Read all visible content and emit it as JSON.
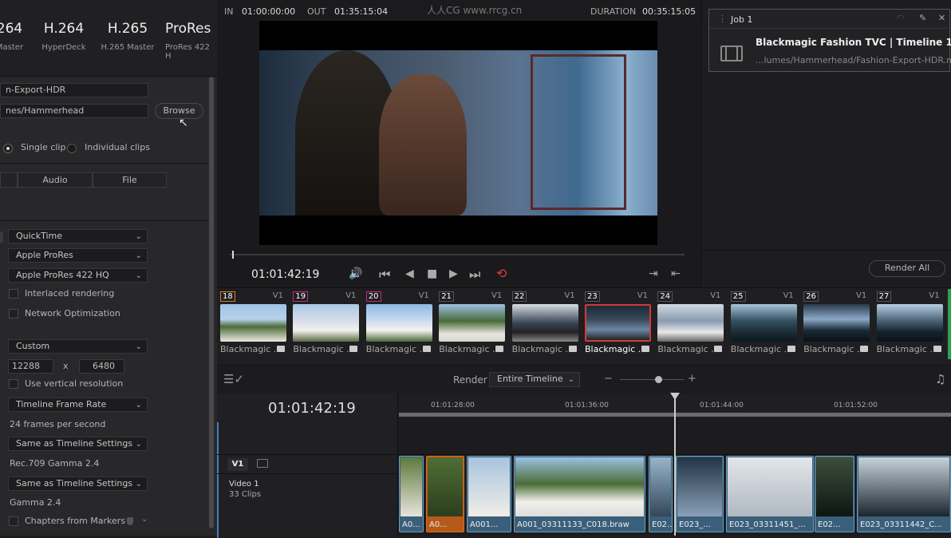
{
  "presets": [
    {
      "title": "264",
      "sub": "Master"
    },
    {
      "title": "H.264",
      "sub": "HyperDeck"
    },
    {
      "title": "H.265",
      "sub": "H.265 Master"
    },
    {
      "title": "ProRes",
      "sub": "ProRes 422 H"
    }
  ],
  "left": {
    "filename": "n-Export-HDR",
    "location": "nes/Hammerhead",
    "browse": "Browse",
    "single_clip": "Single clip",
    "individual_clips": "Individual clips",
    "tabs": [
      "Audio",
      "File"
    ],
    "format": "QuickTime",
    "codec": "Apple ProRes",
    "type": "Apple ProRes 422 HQ",
    "interlaced": "Interlaced rendering",
    "network_opt": "Network Optimization",
    "resolution": "Custom",
    "res_w": "12288",
    "res_x": "x",
    "res_h": "6480",
    "vertical": "Use vertical resolution",
    "frame_rate": "Timeline Frame Rate",
    "fps": "24 frames per second",
    "color_space": "Same as Timeline Settings",
    "color_space_val": "Rec.709 Gamma 2.4",
    "gamma": "Same as Timeline Settings",
    "gamma_val": "Gamma 2.4",
    "chapters": "Chapters from Markers"
  },
  "viewer": {
    "in_label": "IN",
    "in_tc": "01:00:00:00",
    "out_label": "OUT",
    "out_tc": "01:35:15:04",
    "watermark": "人人CG www.rrcg.cn",
    "duration_label": "DURATION",
    "duration_tc": "00:35:15:05",
    "timecode": "01:01:42:19"
  },
  "queue": {
    "job": "Job 1",
    "title": "Blackmagic Fashion TVC | Timeline 1",
    "path": "...lumes/Hammerhead/Fashion-Export-HDR.mov",
    "render_all": "Render All"
  },
  "thumbs": [
    {
      "num": "18",
      "track": "V1",
      "name": "Blackmagic ...",
      "color": "#e07a1a"
    },
    {
      "num": "19",
      "track": "V1",
      "name": "Blackmagic ...",
      "color": "#c02a8a"
    },
    {
      "num": "20",
      "track": "V1",
      "name": "Blackmagic ...",
      "color": "#c02a8a"
    },
    {
      "num": "21",
      "track": "V1",
      "name": "Blackmagic ...",
      "color": "#555"
    },
    {
      "num": "22",
      "track": "V1",
      "name": "Blackmagic ...",
      "color": "#555"
    },
    {
      "num": "23",
      "track": "V1",
      "name": "Blackmagic ...",
      "color": "#555"
    },
    {
      "num": "24",
      "track": "V1",
      "name": "Blackmagic ...",
      "color": "#555"
    },
    {
      "num": "25",
      "track": "V1",
      "name": "Blackmagic ...",
      "color": "#555"
    },
    {
      "num": "26",
      "track": "V1",
      "name": "Blackmagic ...",
      "color": "#555"
    },
    {
      "num": "27",
      "track": "V1",
      "name": "Blackmagic ...",
      "color": "#555"
    }
  ],
  "timeline": {
    "render_label": "Render",
    "render_mode": "Entire Timeline",
    "timecode": "01:01:42:19",
    "ruler": [
      "01:01:28:00",
      "01:01:36:00",
      "01:01:44:00",
      "01:01:52:00"
    ],
    "track": "V1",
    "track_name": "Video 1",
    "track_clips": "33 Clips",
    "clips": [
      "A0...",
      "A0...",
      "A001...",
      "A001_03311133_C018.braw",
      "E02...",
      "E023_...",
      "E023_03311451_...",
      "E02...",
      "E023_03311442_C..."
    ]
  }
}
